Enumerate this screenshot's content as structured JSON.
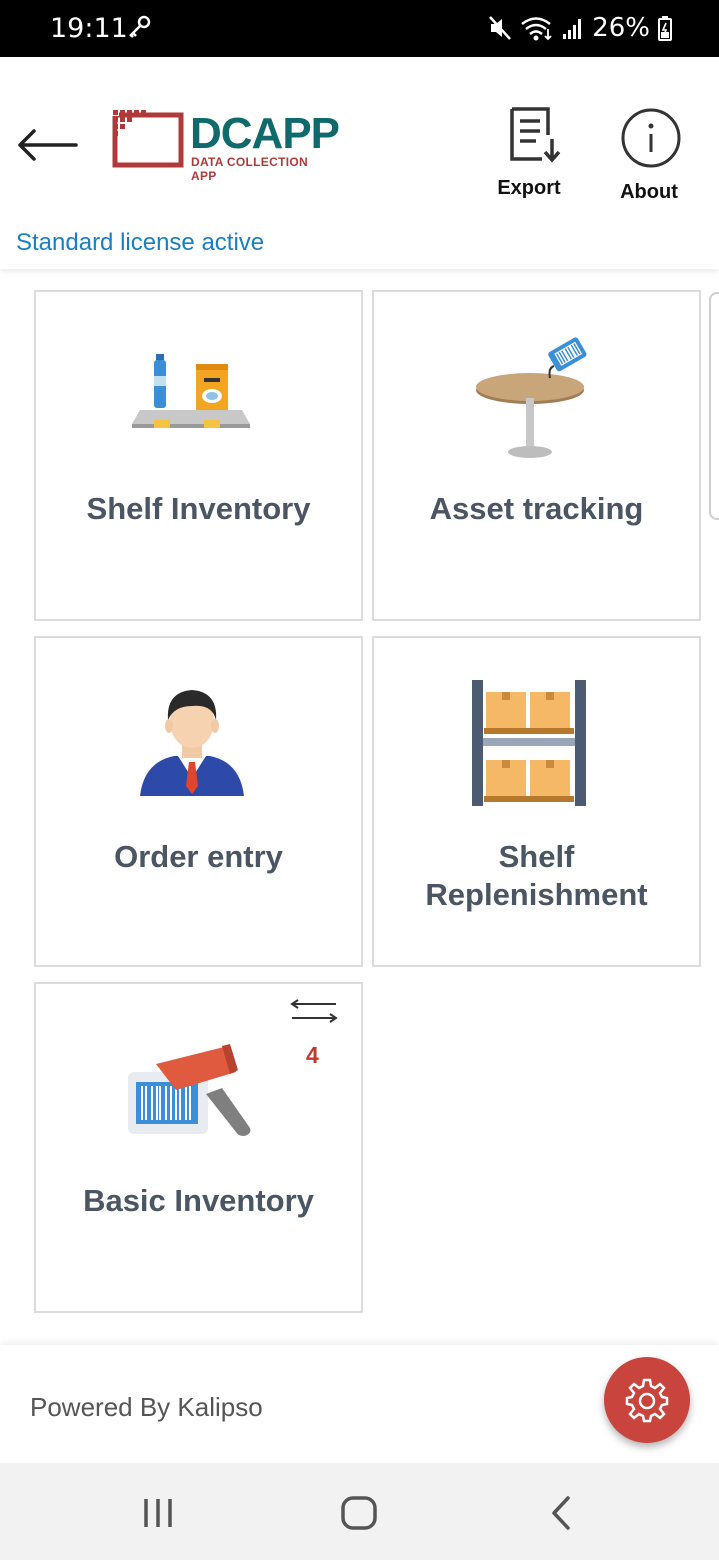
{
  "status_bar": {
    "time": "19:11",
    "battery": "26%"
  },
  "header": {
    "logo_title": "DCAPP",
    "logo_subtitle": "DATA COLLECTION APP",
    "export_label": "Export",
    "about_label": "About",
    "license_text": "Standard license active"
  },
  "tiles": [
    {
      "label": "Shelf Inventory"
    },
    {
      "label": "Asset tracking"
    },
    {
      "label": "Order entry"
    },
    {
      "label_line1": "Shelf",
      "label_line2": "Replenishment"
    },
    {
      "label": "Basic Inventory",
      "badge_count": "4"
    }
  ],
  "footer": {
    "powered_by": "Powered By Kalipso"
  },
  "colors": {
    "accent_red": "#c8443c",
    "license_blue": "#1a7fc2",
    "logo_teal": "#0f6b6b",
    "tile_text": "#4b5563"
  }
}
